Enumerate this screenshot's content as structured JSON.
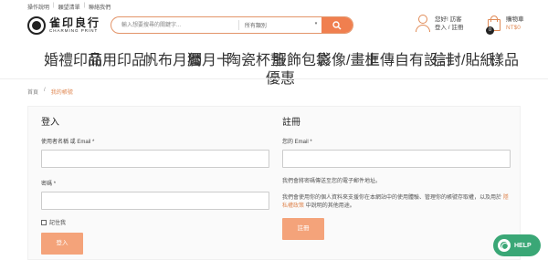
{
  "topbar": {
    "links": [
      "操作說明",
      "願望清單",
      "聯絡我們"
    ]
  },
  "logo": {
    "main": "雀印良行",
    "sub": "CHARMING PRINT"
  },
  "search": {
    "placeholder": "輸入想要搜尋的關鍵字...",
    "category": "所有類別"
  },
  "user": {
    "greeting": "您好! 訪客",
    "action": "登入 / 註冊"
  },
  "cart": {
    "label": "購物車",
    "price": "NT$0",
    "count": "0"
  },
  "nav": {
    "items": [
      {
        "label": "婚禮印品",
        "has_dropdown": true
      },
      {
        "label": "商用印品",
        "has_dropdown": true
      },
      {
        "label": "帆布月曆",
        "has_dropdown": false
      },
      {
        "label": "獨月卡",
        "has_dropdown": false
      },
      {
        "label": "陶瓷杯墊",
        "has_dropdown": false
      },
      {
        "label": "服飾包袋",
        "has_dropdown": false
      },
      {
        "label": "影像/畫框",
        "has_dropdown": false
      },
      {
        "label": "上傳自有設計",
        "has_dropdown": true
      },
      {
        "label": "信封/貼紙",
        "has_dropdown": true
      },
      {
        "label": "樣品",
        "has_dropdown": false
      }
    ],
    "second_row": {
      "label": "優惠"
    }
  },
  "breadcrumb": {
    "home": "首頁",
    "sep": "/",
    "current": "我的帳號"
  },
  "login": {
    "title": "登入",
    "username_label": "使用者名稱 或 Email",
    "password_label": "密碼",
    "req": "*",
    "remember": "記住我",
    "button": "登入"
  },
  "register": {
    "title": "註冊",
    "email_label": "您的 Email",
    "req": "*",
    "notice": "我們會將密碼傳送至您的電子郵件地址。",
    "privacy_prefix": "我們會使用你的個人資料來支援你在本網站中的使用體驗、管理你的帳號存取權，以及用於",
    "privacy_link": "隱私權政策",
    "privacy_suffix": "中說明的其他用途。",
    "button": "註冊"
  },
  "help_button": {
    "label": "HELP"
  },
  "colors": {
    "accent": "#f07f4f",
    "button": "#f4a37a",
    "help": "#3aa776"
  }
}
